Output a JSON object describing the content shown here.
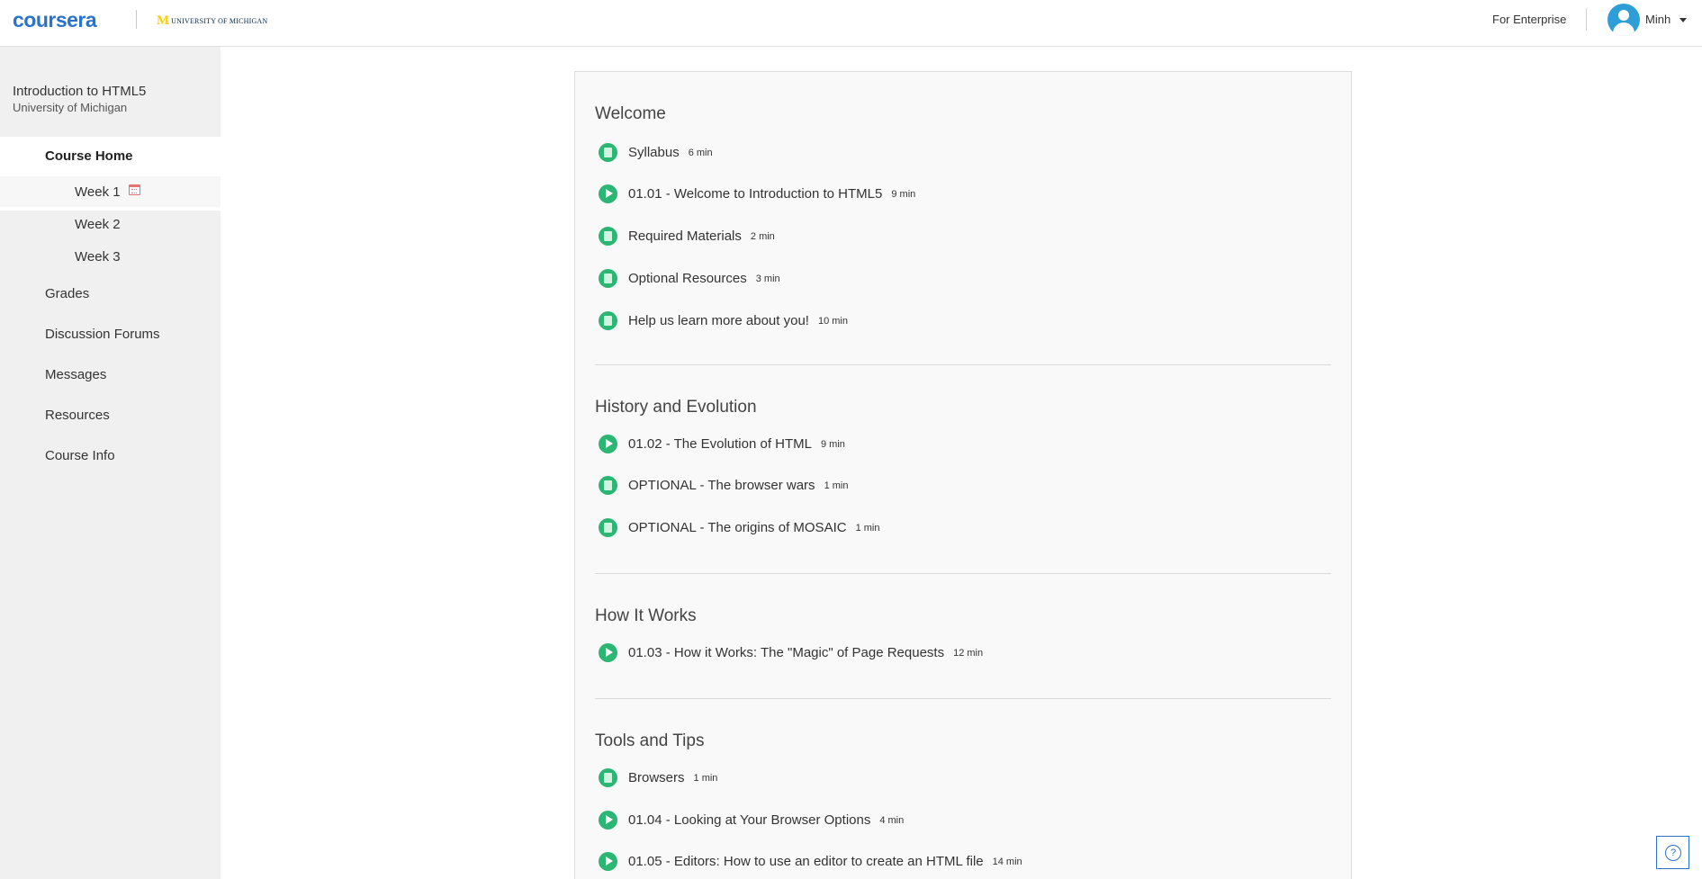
{
  "header": {
    "logo": "coursera",
    "partner_mark": "M",
    "partner_name": "UNIVERSITY OF MICHIGAN",
    "enterprise_link": "For Enterprise",
    "user_name": "Minh",
    "avatar_icon": "user-icon",
    "dropdown_icon": "caret-down-icon"
  },
  "sidebar": {
    "course_title": "Introduction to HTML5",
    "course_provider": "University of Michigan",
    "course_home": "Course Home",
    "weeks": [
      "Week 1",
      "Week 2",
      "Week 3"
    ],
    "current_week_icon": "calendar-icon",
    "nav": [
      "Grades",
      "Discussion Forums",
      "Messages",
      "Resources",
      "Course Info"
    ]
  },
  "main": {
    "sections": [
      {
        "title": "Welcome",
        "items": [
          {
            "type": "reading",
            "label": "Syllabus",
            "duration": "6 min"
          },
          {
            "type": "video",
            "label": "01.01 - Welcome to Introduction to HTML5",
            "duration": "9 min"
          },
          {
            "type": "reading",
            "label": "Required Materials",
            "duration": "2 min"
          },
          {
            "type": "reading",
            "label": "Optional Resources",
            "duration": "3 min"
          },
          {
            "type": "reading",
            "label": "Help us learn more about you!",
            "duration": "10 min"
          }
        ]
      },
      {
        "title": "History and Evolution",
        "items": [
          {
            "type": "video",
            "label": "01.02 - The Evolution of HTML",
            "duration": "9 min"
          },
          {
            "type": "reading",
            "label": "OPTIONAL - The browser wars",
            "duration": "1 min"
          },
          {
            "type": "reading",
            "label": "OPTIONAL - The origins of MOSAIC",
            "duration": "1 min"
          }
        ]
      },
      {
        "title": "How It Works",
        "items": [
          {
            "type": "video",
            "label": "01.03 - How it Works: The \"Magic\" of Page Requests",
            "duration": "12 min"
          }
        ]
      },
      {
        "title": "Tools and Tips",
        "items": [
          {
            "type": "reading",
            "label": "Browsers",
            "duration": "1 min"
          },
          {
            "type": "video",
            "label": "01.04 - Looking at Your Browser Options",
            "duration": "4 min"
          },
          {
            "type": "video",
            "label": "01.05 - Editors: How to use an editor to create an HTML file",
            "duration": "14 min"
          }
        ]
      }
    ]
  },
  "help": {
    "icon": "help-icon",
    "glyph": "?"
  },
  "colors": {
    "brand": "#2a73cc",
    "complete": "#2bb673",
    "sidebar_bg": "#f0f0f0"
  }
}
